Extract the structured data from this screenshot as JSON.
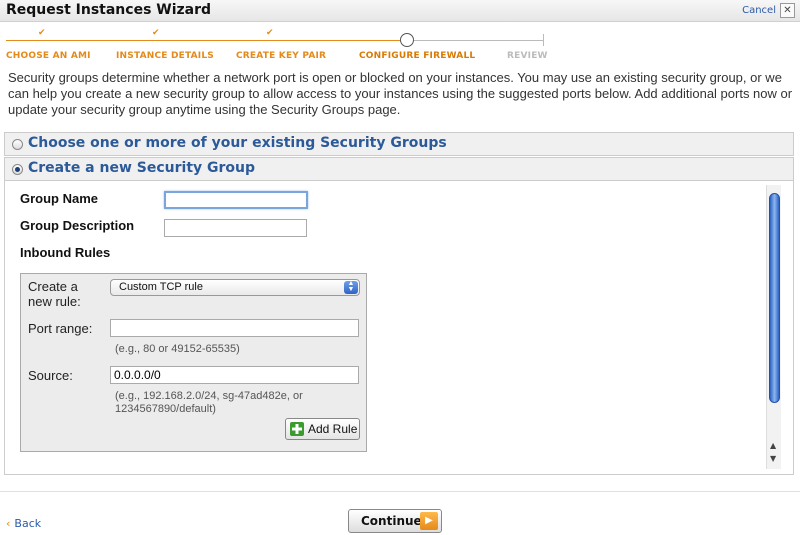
{
  "window": {
    "title": "Request Instances Wizard",
    "cancel_label": "Cancel",
    "close_glyph": "✕"
  },
  "steps": [
    {
      "label": "CHOOSE AN AMI",
      "status": "done"
    },
    {
      "label": "INSTANCE DETAILS",
      "status": "done"
    },
    {
      "label": "CREATE KEY PAIR",
      "status": "done"
    },
    {
      "label": "CONFIGURE FIREWALL",
      "status": "current"
    },
    {
      "label": "REVIEW",
      "status": "todo"
    }
  ],
  "check_glyph": "✔",
  "intro_text": "Security groups determine whether a network port is open or blocked on your instances. You may use an existing security group, or we can help you create a new security group to allow access to your instances using the suggested ports below. Add additional ports now or update your security group anytime using the Security Groups page.",
  "options": {
    "existing_label": "Choose one or more of your existing Security Groups",
    "create_label": "Create a new Security Group",
    "selected": "create"
  },
  "form": {
    "group_name_label": "Group Name",
    "group_name_value": "",
    "group_description_label": "Group Description",
    "group_description_value": "",
    "inbound_rules_label": "Inbound Rules"
  },
  "rule": {
    "create_label_line1": "Create a",
    "create_label_line2": "new rule:",
    "rule_type_value": "Custom TCP rule",
    "port_range_label": "Port range:",
    "port_range_value": "",
    "port_range_hint": "(e.g., 80 or 49152-65535)",
    "source_label": "Source:",
    "source_value": "0.0.0.0/0",
    "source_hint_line1": "(e.g., 192.168.2.0/24, sg-47ad482e, or",
    "source_hint_line2": "1234567890/default)",
    "add_rule_label": "Add Rule"
  },
  "footer": {
    "back_label": "Back",
    "back_glyph": "‹",
    "continue_label": "Continue",
    "continue_glyph": "▶"
  },
  "colors": {
    "accent": "#e48a1a",
    "link": "#2a5aa8",
    "section_text": "#2c5a99"
  }
}
